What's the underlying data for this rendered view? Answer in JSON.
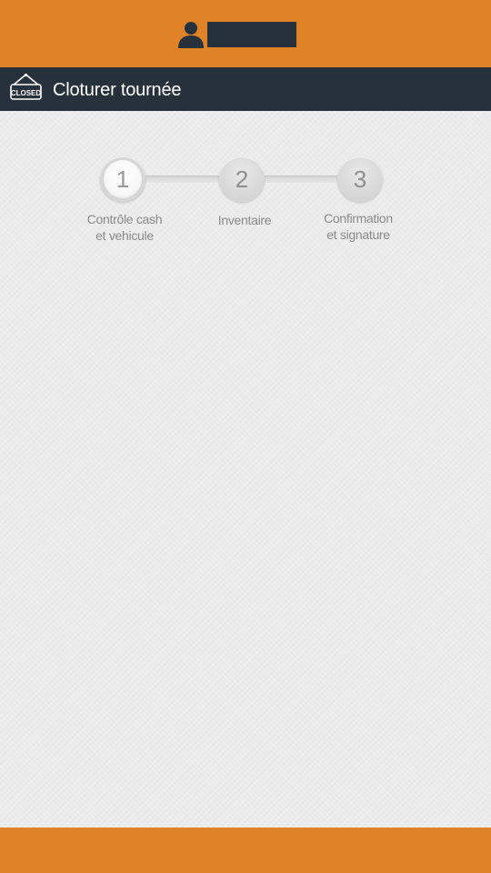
{
  "header": {
    "user_name": ""
  },
  "title_bar": {
    "icon_text": "CLOSED",
    "title": "Cloturer tournée"
  },
  "steps": [
    {
      "number": "1",
      "label_line1": "Contrôle cash",
      "label_line2": "et vehicule",
      "active": true
    },
    {
      "number": "2",
      "label_line1": "Inventaire",
      "label_line2": "",
      "active": false
    },
    {
      "number": "3",
      "label_line1": "Confirmation",
      "label_line2": "et signature",
      "active": false
    }
  ],
  "icons": {
    "user": "user-icon",
    "closed_sign": "closed-sign-icon"
  },
  "colors": {
    "brand_orange": "#e08326",
    "dark_bar": "#27313c",
    "background": "#ececec"
  }
}
